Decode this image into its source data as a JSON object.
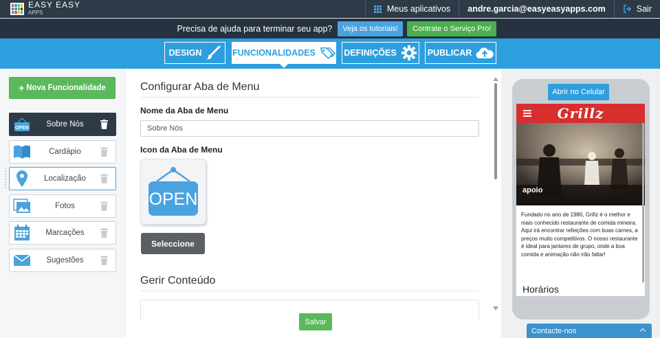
{
  "topbar": {
    "logo_line1": "EASY EASY",
    "logo_line2": "APPS",
    "my_apps": "Meus aplicativos",
    "user_email": "andre.garcia@easyeasyapps.com",
    "logout": "Sair"
  },
  "helpbar": {
    "text": "Precisa de ajuda para terminar seu app?",
    "tutorials_button": "Veja os tutoriais!",
    "pro_button": "Contrate o Serviço Pro!"
  },
  "nav": {
    "tabs": [
      {
        "label": "DESIGN",
        "icon": "brush-icon"
      },
      {
        "label": "FUNCIONALIDADES",
        "icon": "tags-icon",
        "active": true
      },
      {
        "label": "DEFINIÇÕES",
        "icon": "gear-icon"
      },
      {
        "label": "PUBLICAR",
        "icon": "cloud-upload-icon"
      }
    ]
  },
  "sidebar": {
    "new_button": "Nova Funcionalidade",
    "items": [
      {
        "label": "Sobre Nós",
        "icon": "open-sign-icon",
        "active": true
      },
      {
        "label": "Cardápio",
        "icon": "book-icon"
      },
      {
        "label": "Localização",
        "icon": "map-pin-icon"
      },
      {
        "label": "Fotos",
        "icon": "photos-icon"
      },
      {
        "label": "Marcações",
        "icon": "calendar-icon"
      },
      {
        "label": "Sugestões",
        "icon": "envelope-icon"
      }
    ]
  },
  "main": {
    "section_title": "Configurar Aba de Menu",
    "name_label": "Nome da Aba de Menu",
    "name_value": "Sobre Nós",
    "icon_label": "Icon da Aba de Menu",
    "icon_sign_text": "OPEN",
    "select_button": "Seleccione",
    "content_title": "Gerir Conteúdo",
    "save_button": "Salvar"
  },
  "preview": {
    "open_button": "Abrir no Celular",
    "brand": "Grillz",
    "hero_title": "apoio",
    "paragraph": "Fundado no ano de 1980, Grillz é o melhor e mais conhecido restaurante de comida mineira. Aqui irá encontrar refeições com boas carnes, a preços muito competitivos. O nosso restaurante é ideal para jantares de grupo, onde a boa comida e animação não irão faltar!",
    "heading": "Horários"
  },
  "contact": {
    "label": "Contacte-nos"
  },
  "colors": {
    "topbar": "#2e3a47",
    "accent_blue": "#2d9fdf",
    "green": "#5cb85c",
    "brand_red": "#d72e2e"
  }
}
